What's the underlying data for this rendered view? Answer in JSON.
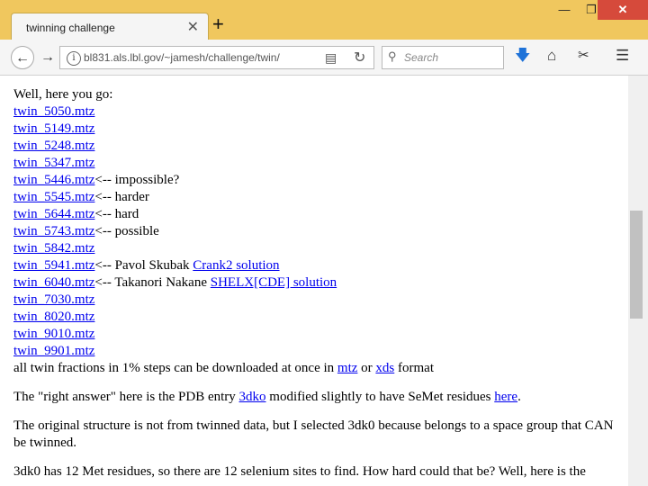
{
  "browser": {
    "tab_title": "twinning challenge",
    "tab_close": "✕",
    "new_tab": "+",
    "window_controls": {
      "minimize": "—",
      "maximize": "❐",
      "close": "✕"
    },
    "url": "bl831.als.lbl.gov/~jamesh/challenge/twin/",
    "search_placeholder": "Search",
    "icons": {
      "back": "back-arrow-icon",
      "forward": "forward-arrow-icon",
      "info": "info-icon",
      "reader": "reader-view-icon",
      "reload": "reload-icon",
      "search": "search-icon",
      "download": "download-icon",
      "home": "home-icon",
      "screenshot": "screenshot-icon",
      "menu": "hamburger-menu-icon"
    },
    "accent_color": "#f0c75e",
    "link_color": "#0000ee"
  },
  "page": {
    "intro": "Well, here you go:",
    "files": [
      {
        "name": "twin_5050.mtz",
        "note": ""
      },
      {
        "name": "twin_5149.mtz",
        "note": ""
      },
      {
        "name": "twin_5248.mtz",
        "note": ""
      },
      {
        "name": "twin_5347.mtz",
        "note": ""
      },
      {
        "name": "twin_5446.mtz",
        "note": "<-- impossible?"
      },
      {
        "name": "twin_5545.mtz",
        "note": "<-- harder"
      },
      {
        "name": "twin_5644.mtz",
        "note": "<-- hard"
      },
      {
        "name": "twin_5743.mtz",
        "note": "<-- possible"
      },
      {
        "name": "twin_5842.mtz",
        "note": ""
      },
      {
        "name": "twin_5941.mtz",
        "note": "<-- Pavol Skubak ",
        "link": "Crank2 solution"
      },
      {
        "name": "twin_6040.mtz",
        "note": "<-- Takanori Nakane ",
        "link": "SHELX[CDE] solution"
      },
      {
        "name": "twin_7030.mtz",
        "note": ""
      },
      {
        "name": "twin_8020.mtz",
        "note": ""
      },
      {
        "name": "twin_9010.mtz",
        "note": ""
      },
      {
        "name": "twin_9901.mtz",
        "note": ""
      }
    ],
    "all_fractions": {
      "text_before": "all twin fractions in 1% steps can be downloaded at once in ",
      "link1": "mtz",
      "text_middle": " or ",
      "link2": "xds",
      "text_after": " format"
    },
    "answer": {
      "text_before": "The \"right answer\" here is the PDB entry ",
      "link1": "3dko",
      "text_middle": " modified slightly to have SeMet residues ",
      "link2": "here",
      "text_after": "."
    },
    "original_structure": "The original structure is not from twinned data, but I selected 3dk0 because belongs to a space group that CAN be twinned.",
    "met_residues": "3dk0 has 12 Met residues, so there are 12 selenium sites to find. How hard could that be? Well, here is the"
  }
}
